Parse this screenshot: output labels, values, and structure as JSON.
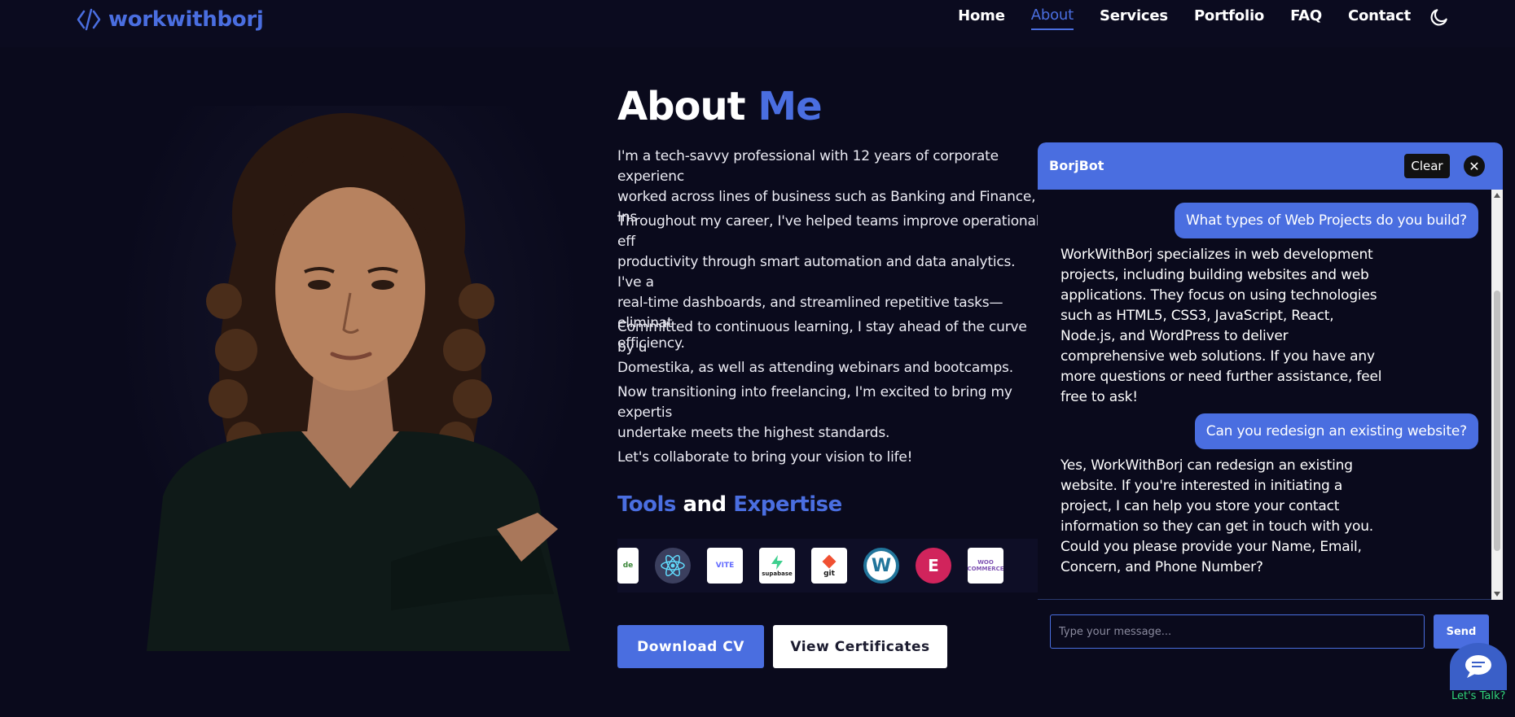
{
  "header": {
    "logo_text": "workwithborj",
    "nav": [
      "Home",
      "About",
      "Services",
      "Portfolio",
      "FAQ",
      "Contact"
    ],
    "active_nav": "About"
  },
  "about": {
    "title_part1": "About",
    "title_part2": "Me",
    "paragraphs": [
      "I'm a tech-savvy professional with 12 years of corporate experienc\nworked across lines of business such as Banking and Finance, Ins",
      "Throughout my career, I've helped teams improve operational eff\nproductivity through smart automation and data analytics. I've a\nreal-time dashboards, and streamlined repetitive tasks—eliminat\nefficiency.",
      "Committed to continuous learning, I stay ahead of the curve by u\nDomestika, as well as attending webinars and bootcamps.",
      "Now transitioning into freelancing, I'm excited to bring my expertis\nundertake meets the highest standards.",
      "Let's collaborate to bring your vision to life!"
    ],
    "tools_title_part1": "Tools",
    "tools_title_mid": "and",
    "tools_title_part2": "Expertise",
    "tools": [
      {
        "name": "nodejs-icon",
        "label": "de"
      },
      {
        "name": "react-icon",
        "label": "React"
      },
      {
        "name": "vite-icon",
        "label": "VITE"
      },
      {
        "name": "supabase-icon",
        "label": "supabase"
      },
      {
        "name": "git-icon",
        "label": "git"
      },
      {
        "name": "wordpress-icon",
        "label": "W"
      },
      {
        "name": "elementor-icon",
        "label": "E"
      },
      {
        "name": "woocommerce-icon",
        "label": "WOO COMMERCE"
      }
    ],
    "download_cv_label": "Download CV",
    "view_certificates_label": "View Certificates"
  },
  "chat": {
    "title": "BorjBot",
    "clear_label": "Clear",
    "messages": [
      {
        "role": "user",
        "text": "What types of Web Projects do you build?"
      },
      {
        "role": "bot",
        "text": "WorkWithBorj specializes in web development projects, including building websites and web applications. They focus on using technologies such as HTML5, CSS3, JavaScript, React, Node.js, and WordPress to deliver comprehensive web solutions. If you have any more questions or need further assistance, feel free to ask!"
      },
      {
        "role": "user",
        "text": "Can you redesign an existing website?"
      },
      {
        "role": "bot",
        "text": "Yes, WorkWithBorj can redesign an existing website. If you're interested in initiating a project, I can help you store your contact information so they can get in touch with you. Could you please provide your Name, Email, Concern, and Phone Number?"
      }
    ],
    "input_placeholder": "Type your message...",
    "send_label": "Send"
  },
  "launcher": {
    "label": "Let's Talk?"
  },
  "colors": {
    "accent": "#4a6ee0",
    "background": "#0a0a1c",
    "launcher_label": "#2fd47a"
  }
}
